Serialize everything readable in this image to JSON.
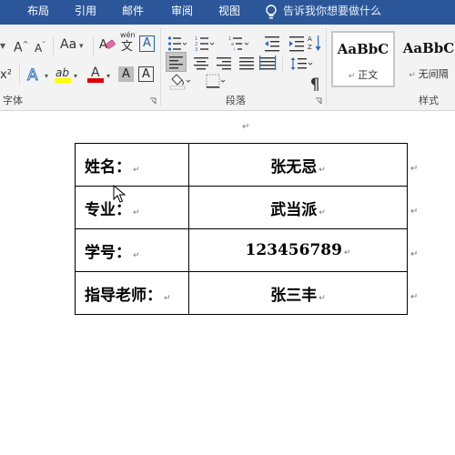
{
  "tabs": [
    "布局",
    "引用",
    "邮件",
    "审阅",
    "视图"
  ],
  "tell_me": "告诉我你想要做什么",
  "ribbon": {
    "font_group": {
      "label": "字体",
      "grow_font": "A",
      "shrink_font": "A",
      "change_case": "Aa",
      "phonetic_guide": "wén",
      "enclosed_char": "A",
      "superscript": "x²",
      "text_effects": "A",
      "highlight": "ab",
      "font_color": "A",
      "char_shading": "A",
      "char_border": "A"
    },
    "paragraph_group": {
      "label": "段落"
    },
    "styles_group": {
      "label": "样式",
      "styles": [
        {
          "sample": "AaBbC",
          "name": "正文"
        },
        {
          "sample": "AaBbC",
          "name": "无间隔"
        }
      ]
    }
  },
  "document": {
    "paragraph_mark": "↵",
    "table": [
      {
        "label": "姓名：",
        "value": "张无忌"
      },
      {
        "label": "专业：",
        "value": "武当派"
      },
      {
        "label": "学号：",
        "value": "123456789"
      },
      {
        "label": "指导老师：",
        "value": "张三丰"
      }
    ]
  }
}
